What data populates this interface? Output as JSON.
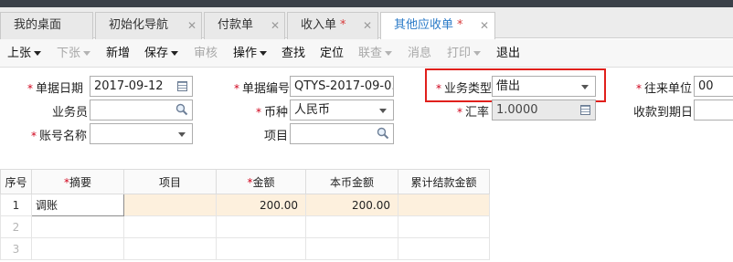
{
  "tabs": [
    {
      "label": "我的桌面",
      "closable": false,
      "modified": false,
      "active": false
    },
    {
      "label": "初始化导航",
      "closable": true,
      "modified": false,
      "active": false
    },
    {
      "label": "付款单",
      "closable": true,
      "modified": false,
      "active": false
    },
    {
      "label": "收入单",
      "closable": true,
      "modified": true,
      "active": false
    },
    {
      "label": "其他应收单",
      "closable": true,
      "modified": true,
      "active": true
    }
  ],
  "toolbar": {
    "items": [
      {
        "label": "上张",
        "dropdown": true,
        "enabled": true
      },
      {
        "label": "下张",
        "dropdown": true,
        "enabled": false
      },
      {
        "label": "新增",
        "dropdown": false,
        "enabled": true
      },
      {
        "label": "保存",
        "dropdown": true,
        "enabled": true
      },
      {
        "label": "审核",
        "dropdown": false,
        "enabled": false
      },
      {
        "label": "操作",
        "dropdown": true,
        "enabled": true
      },
      {
        "label": "查找",
        "dropdown": false,
        "enabled": true
      },
      {
        "label": "定位",
        "dropdown": false,
        "enabled": true
      },
      {
        "label": "联查",
        "dropdown": true,
        "enabled": false
      },
      {
        "label": "消息",
        "dropdown": false,
        "enabled": false
      },
      {
        "label": "打印",
        "dropdown": true,
        "enabled": false
      },
      {
        "label": "退出",
        "dropdown": false,
        "enabled": true
      }
    ]
  },
  "form": {
    "doc_date": {
      "label": "单据日期",
      "value": "2017-09-12",
      "required": true
    },
    "doc_no": {
      "label": "单据编号",
      "value": "QTYS-2017-09-0...",
      "required": true
    },
    "business_type": {
      "label": "业务类型",
      "value": "借出",
      "required": true
    },
    "partner": {
      "label": "往来单位",
      "value": "00",
      "required": true
    },
    "salesperson": {
      "label": "业务员",
      "value": "",
      "required": false
    },
    "currency": {
      "label": "币种",
      "value": "人民币",
      "required": true
    },
    "exchange_rate": {
      "label": "汇率",
      "value": "1.0000",
      "required": true
    },
    "due_date": {
      "label": "收款到期日",
      "value": "",
      "required": false
    },
    "account_name": {
      "label": "账号名称",
      "value": "",
      "required": true
    },
    "project": {
      "label": "项目",
      "value": "",
      "required": false
    }
  },
  "grid": {
    "columns": [
      {
        "label": "序号",
        "required": false
      },
      {
        "label": "摘要",
        "required": true
      },
      {
        "label": "项目",
        "required": false
      },
      {
        "label": "金额",
        "required": true
      },
      {
        "label": "本币金额",
        "required": false
      },
      {
        "label": "累计结款金额",
        "required": false
      }
    ],
    "rows": [
      {
        "no": "1",
        "summary": "调账",
        "project": "",
        "amount": "200.00",
        "local_amount": "200.00",
        "settled": ""
      },
      {
        "no": "2",
        "summary": "",
        "project": "",
        "amount": "",
        "local_amount": "",
        "settled": ""
      },
      {
        "no": "3",
        "summary": "",
        "project": "",
        "amount": "",
        "local_amount": "",
        "settled": ""
      }
    ]
  },
  "colors": {
    "accent": "#2b7bc8",
    "required_star": "#d0021b",
    "highlight_box": "#e0201c",
    "row_highlight": "#fdf0dd"
  }
}
